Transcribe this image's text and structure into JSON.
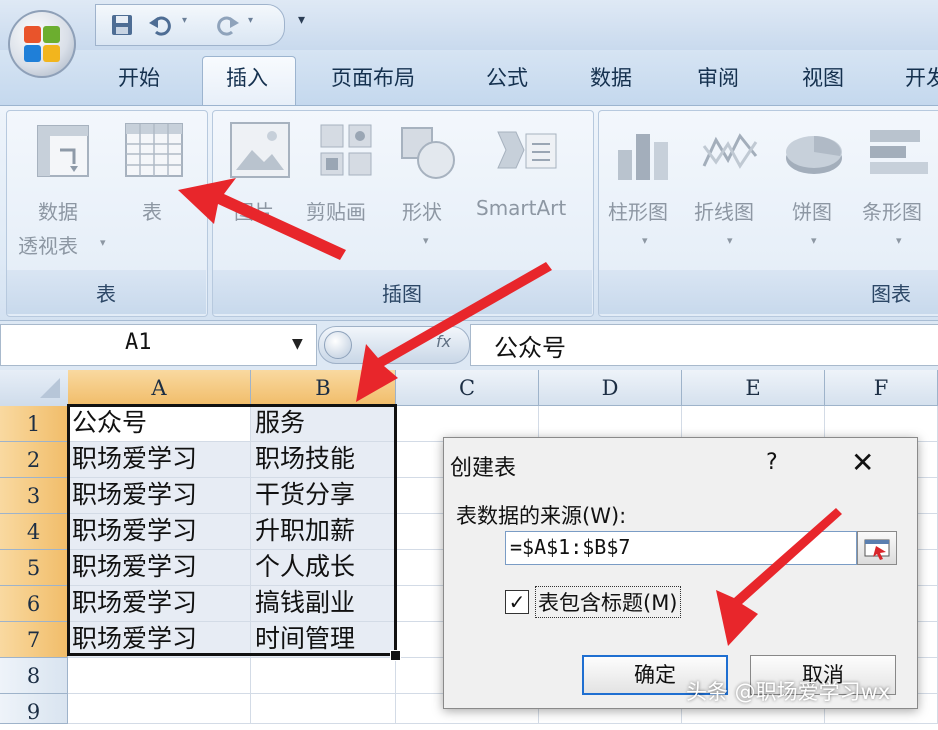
{
  "quick_access": {
    "save_icon": "floppy-disk-icon",
    "undo_icon": "undo-icon",
    "redo_icon": "redo-icon",
    "customize_glyph": "▾"
  },
  "tabs": [
    {
      "label": "开始"
    },
    {
      "label": "插入"
    },
    {
      "label": "页面布局"
    },
    {
      "label": "公式"
    },
    {
      "label": "数据"
    },
    {
      "label": "审阅"
    },
    {
      "label": "视图"
    },
    {
      "label": "开发"
    }
  ],
  "ribbon": {
    "tables_group": {
      "label": "表",
      "pivot_label_1": "数据",
      "pivot_label_2": "透视表",
      "table_label": "表"
    },
    "illustrations_group": {
      "label": "插图",
      "picture_label": "图片",
      "clipart_label": "剪贴画",
      "shapes_label": "形状",
      "smartart_label": "SmartArt"
    },
    "charts_group": {
      "label": "图表",
      "column_label": "柱形图",
      "line_label": "折线图",
      "pie_label": "饼图",
      "bar_label": "条形图"
    }
  },
  "formula_bar": {
    "name_box": "A1",
    "fx": "fx",
    "content": "公众号"
  },
  "sheet": {
    "columns": [
      "A",
      "B",
      "C",
      "D",
      "E",
      "F"
    ],
    "rows": [
      "1",
      "2",
      "3",
      "4",
      "5",
      "6",
      "7",
      "8",
      "9"
    ],
    "data": [
      [
        "公众号",
        "服务"
      ],
      [
        "职场爱学习",
        "职场技能"
      ],
      [
        "职场爱学习",
        "干货分享"
      ],
      [
        "职场爱学习",
        "升职加薪"
      ],
      [
        "职场爱学习",
        "个人成长"
      ],
      [
        "职场爱学习",
        "搞钱副业"
      ],
      [
        "职场爱学习",
        "时间管理"
      ]
    ]
  },
  "dialog": {
    "title": "创建表",
    "help": "?",
    "close": "✕",
    "source_label": "表数据的来源(W):",
    "range_value": "=$A$1:$B$7",
    "has_headers_label": "表包含标题(M)",
    "has_headers_checked": "✓",
    "ok_label": "确定",
    "cancel_label": "取消"
  },
  "watermark": "头条 @职场爱学习wx",
  "colors": {
    "arrow_red": "#e8262b",
    "selected_header": "#f4c57a",
    "ribbon_blue": "#dfeaf6"
  }
}
